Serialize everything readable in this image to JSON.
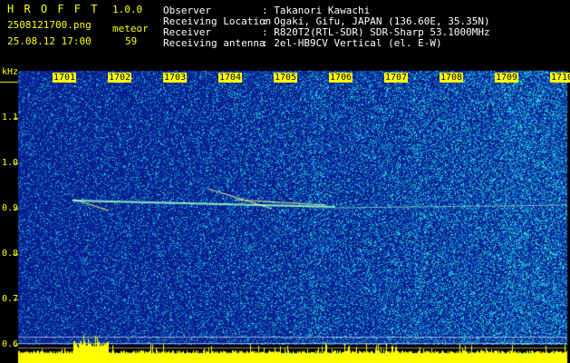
{
  "header": {
    "app_title": "H R O F F T",
    "version": "1.0.0",
    "filename": "2508121700.png",
    "timestamp": "25.08.12 17:00",
    "counter_label": "meteor",
    "counter_value": "59",
    "info_labels": [
      "Observer",
      "Receiving Location",
      "Receiver",
      "Receiving antenna"
    ],
    "info_values": [
      ": Takanori Kawachi",
      ": Ogaki, Gifu, JAPAN (136.60E, 35.35N)",
      ": R820T2(RTL-SDR) SDR-Sharp 53.1000MHz",
      ": 2el-HB9CV Vertical (el. E-W)"
    ]
  },
  "chart_data": {
    "type": "heatmap",
    "ylabel": "kHz",
    "y_ticks": [
      "1.1",
      "1.0",
      "0.9",
      "0.8",
      "0.7",
      "0.6"
    ],
    "x_ticks": [
      "1701",
      "1702",
      "1703",
      "1704",
      "1705",
      "1706",
      "1707",
      "1708",
      "1709",
      "1710"
    ],
    "colors": {
      "background": "#000000",
      "text_yellow": "#ffff00",
      "noise_low": "#0a1a8c",
      "noise_high": "#2ec4d4",
      "level_bar": "#ffff00",
      "level_base": "#00d8ff"
    }
  }
}
